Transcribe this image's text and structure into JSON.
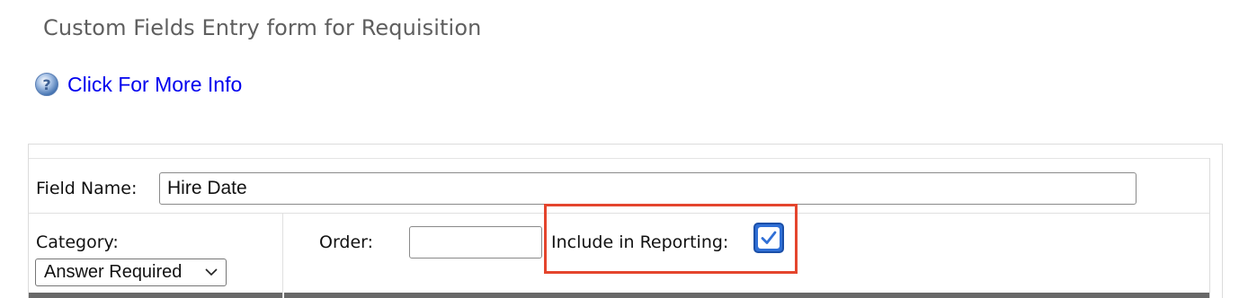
{
  "page": {
    "title": "Custom Fields Entry form for Requisition"
  },
  "info_link": {
    "label": "Click For More Info",
    "icon": "help-icon"
  },
  "form": {
    "field_name": {
      "label": "Field Name:",
      "value": "Hire Date"
    },
    "category": {
      "label": "Category:",
      "selected": "Answer Required"
    },
    "order": {
      "label": "Order:",
      "value": ""
    },
    "include_in_reporting": {
      "label": "Include in Reporting:",
      "checked": true
    }
  },
  "colors": {
    "link": "#0000ee",
    "highlight": "#e4452d",
    "checkbox": "#2f6fd6"
  }
}
